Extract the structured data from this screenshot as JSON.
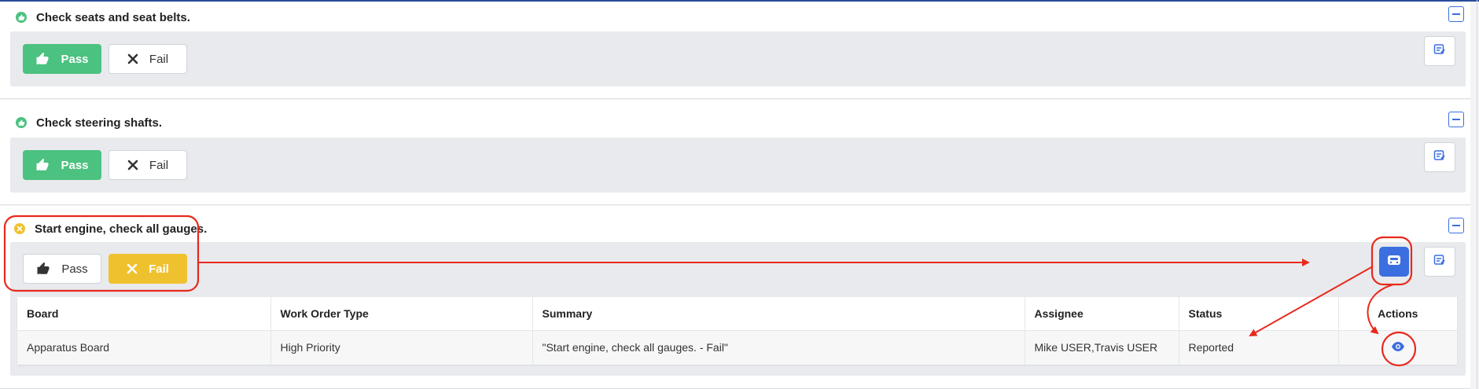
{
  "items": [
    {
      "title": "Check seats and seat belts.",
      "status": "pass"
    },
    {
      "title": "Check steering shafts.",
      "status": "pass"
    },
    {
      "title": "Start engine, check all gauges.",
      "status": "fail"
    }
  ],
  "buttons": {
    "pass_label": "Pass",
    "fail_label": "Fail"
  },
  "work_order_table": {
    "columns": [
      "Board",
      "Work Order Type",
      "Summary",
      "Assignee",
      "Status",
      "Actions"
    ],
    "rows": [
      {
        "board": "Apparatus Board",
        "type": "High Priority",
        "summary": "\"Start engine, check all gauges. - Fail\"",
        "assignee": "Mike USER,Travis USER",
        "status": "Reported"
      }
    ]
  },
  "colors": {
    "pass_green": "#4bc27f",
    "fail_yellow": "#f0c12e",
    "accent_blue": "#3b6fe0",
    "annotation_red": "#e8291c"
  },
  "icons": [
    "thumbs-up-icon",
    "x-icon",
    "note-edit-icon",
    "minus-icon",
    "work-order-icon",
    "eye-icon"
  ]
}
